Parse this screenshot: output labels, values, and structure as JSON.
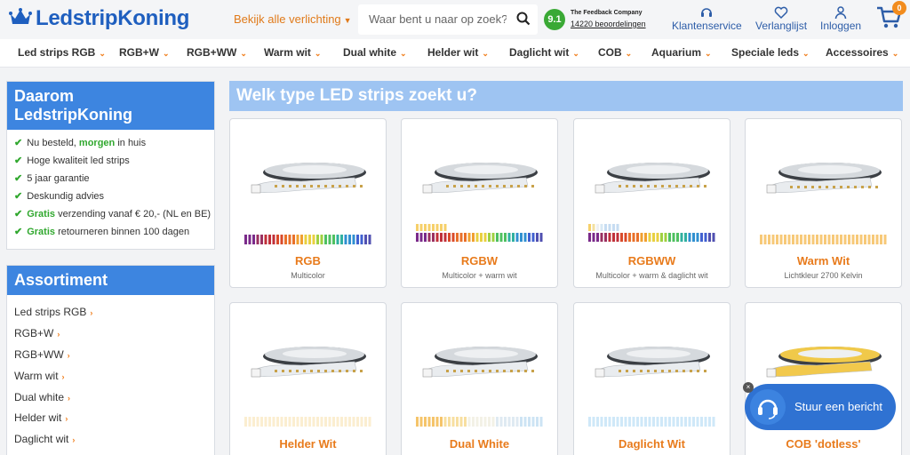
{
  "header": {
    "logo_text": "LedstripKoning",
    "browse_all": "Bekijk alle verlichting",
    "search_placeholder": "Waar bent u naar op zoek?",
    "rating_score": "9.1",
    "rating_company": "The Feedback Company",
    "rating_reviews": "14220 beoordelingen",
    "customer_service": "Klantenservice",
    "wishlist": "Verlanglijst",
    "login": "Inloggen",
    "cart_count": "0"
  },
  "nav": [
    {
      "label": "Led strips RGB"
    },
    {
      "label": "RGB+W"
    },
    {
      "label": "RGB+WW"
    },
    {
      "label": "Warm wit"
    },
    {
      "label": "Dual white"
    },
    {
      "label": "Helder wit"
    },
    {
      "label": "Daglicht wit"
    },
    {
      "label": "COB"
    },
    {
      "label": "Aquarium"
    },
    {
      "label": "Speciale leds"
    },
    {
      "label": "Accessoires"
    }
  ],
  "why": {
    "title_line1": "Daarom",
    "title_line2": "LedstripKoning",
    "usps": [
      {
        "pre": "Nu besteld, ",
        "hl": "morgen",
        "post": " in huis"
      },
      {
        "pre": "Hoge kwaliteit led strips",
        "hl": "",
        "post": ""
      },
      {
        "pre": "5 jaar garantie",
        "hl": "",
        "post": ""
      },
      {
        "pre": "Deskundig advies",
        "hl": "",
        "post": ""
      },
      {
        "pre": "",
        "hl": "Gratis",
        "post": " verzending vanaf € 20,- (NL en BE)"
      },
      {
        "pre": "",
        "hl": "Gratis",
        "post": " retourneren binnen 100 dagen"
      }
    ]
  },
  "assortment": {
    "title": "Assortiment",
    "items": [
      "Led strips RGB",
      "RGB+W",
      "RGB+WW",
      "Warm wit",
      "Dual white",
      "Helder wit",
      "Daglicht wit"
    ]
  },
  "main": {
    "title": "Welk type LED strips zoekt u?",
    "products": [
      {
        "name": "RGB",
        "sub": "Multicolor",
        "spectrum": "rgb"
      },
      {
        "name": "RGBW",
        "sub": "Multicolor + warm wit",
        "spectrum": "rgbw"
      },
      {
        "name": "RGBWW",
        "sub": "Multicolor + warm & daglicht wit",
        "spectrum": "rgbww"
      },
      {
        "name": "Warm Wit",
        "sub": "Lichtkleur 2700 Kelvin",
        "spectrum": "warm"
      },
      {
        "name": "Helder Wit",
        "sub": "",
        "spectrum": "helder"
      },
      {
        "name": "Dual White",
        "sub": "",
        "spectrum": "dual"
      },
      {
        "name": "Daglicht Wit",
        "sub": "",
        "spectrum": "daglicht"
      },
      {
        "name": "COB 'dotless'",
        "sub": "",
        "spectrum": "cob"
      }
    ]
  },
  "chat": {
    "label": "Stuur een bericht",
    "close": "×"
  },
  "colors": {
    "brand_blue": "#1f5fbf",
    "accent_orange": "#e87b1c",
    "green": "#31a82f",
    "panel_blue": "#3d85e0"
  }
}
